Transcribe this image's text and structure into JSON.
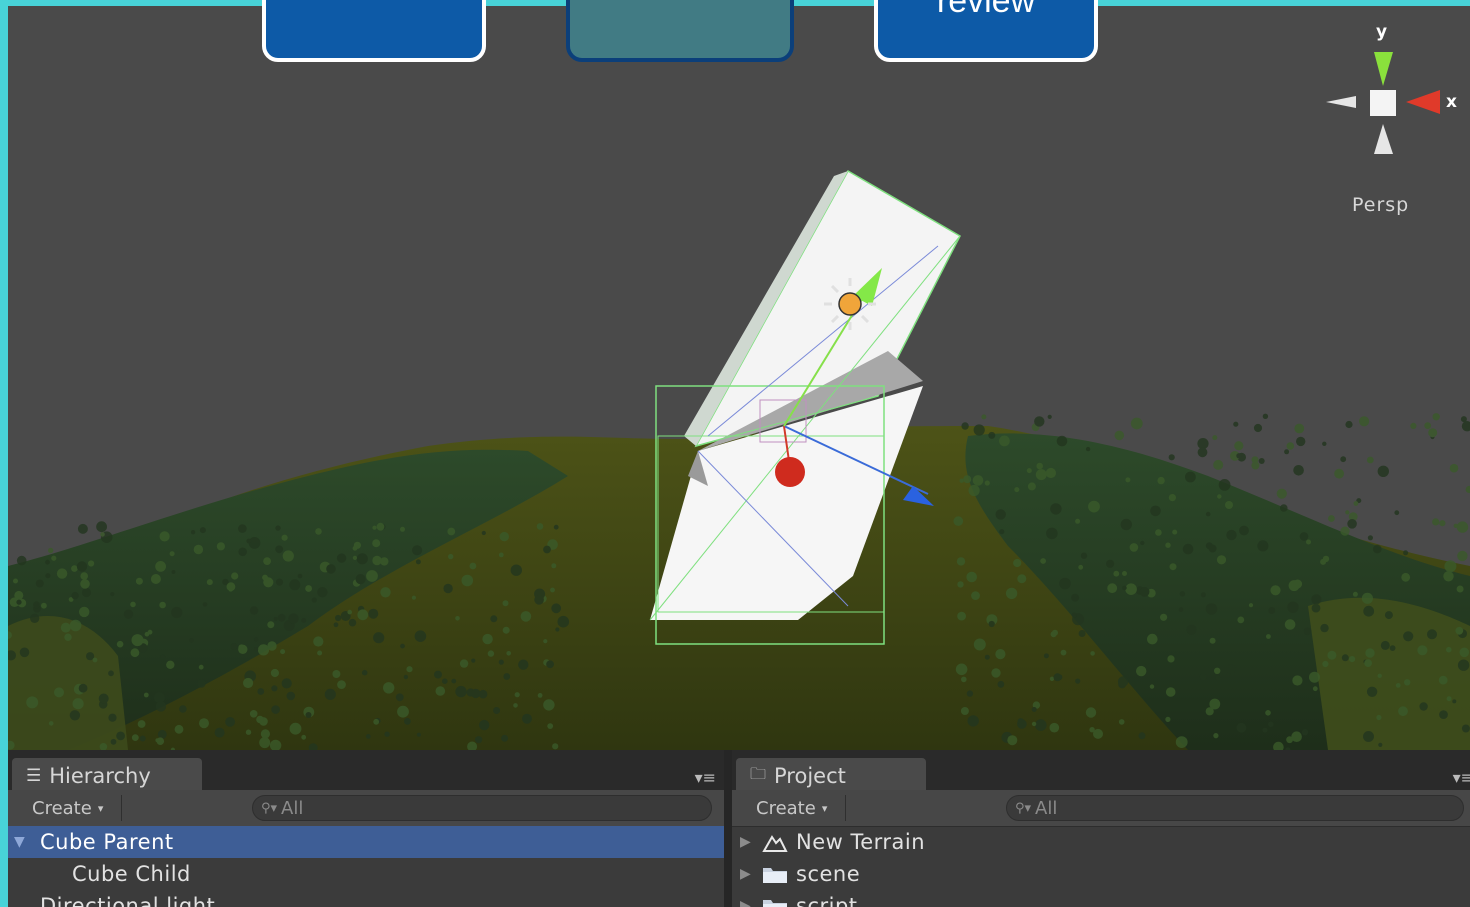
{
  "slide_buttons": [
    {
      "label": ""
    },
    {
      "label": ""
    },
    {
      "label": "review"
    }
  ],
  "scene_view": {
    "projection_label": "Persp",
    "gizmo_axes": {
      "x": "x",
      "y": "y"
    }
  },
  "hierarchy": {
    "tab_label": "Hierarchy",
    "create_label": "Create",
    "search_placeholder": "All",
    "items": [
      {
        "label": "Cube Parent",
        "selected": true
      },
      {
        "label": "Cube Child",
        "selected": false
      },
      {
        "label": "Directional light",
        "selected": false
      }
    ]
  },
  "project": {
    "tab_label": "Project",
    "create_label": "Create",
    "search_placeholder": "All",
    "items": [
      {
        "label": "New Terrain",
        "icon": "terrain-icon"
      },
      {
        "label": "scene",
        "icon": "folder-icon"
      },
      {
        "label": "script",
        "icon": "folder-icon"
      }
    ]
  },
  "colors": {
    "slide_background": "#48d3d8",
    "button_blue": "#0d5aa7",
    "button_teal": "#417b84",
    "selection": "#3e5e96"
  }
}
